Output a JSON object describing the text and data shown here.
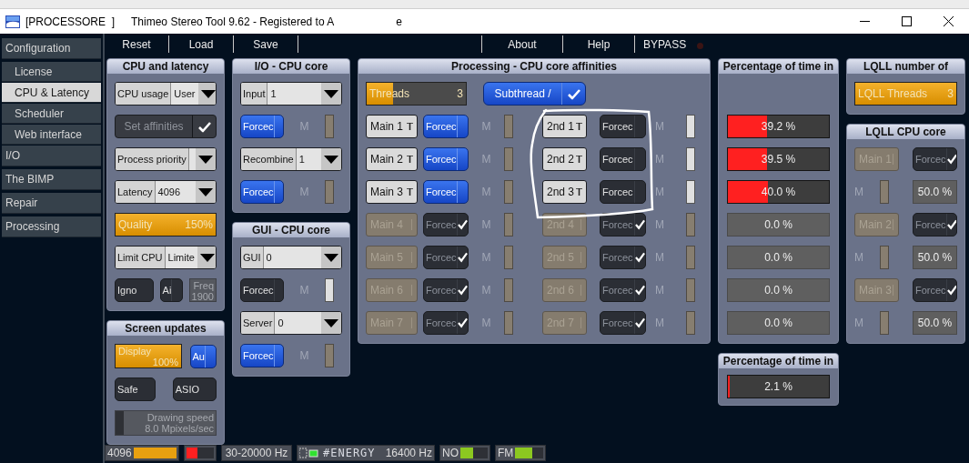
{
  "window": {
    "title_tag": "[PROCESSORE  ]",
    "title": "Thimeo Stereo Tool 9.62 - Registered to A",
    "title_tail": "e"
  },
  "sidebar": {
    "items": [
      {
        "label": "Configuration",
        "selected": false,
        "children": [
          {
            "label": "License",
            "selected": false
          },
          {
            "label": "CPU & Latency",
            "selected": true
          },
          {
            "label": "Scheduler",
            "selected": false
          },
          {
            "label": "Web interface",
            "selected": false
          }
        ]
      },
      {
        "label": "I/O",
        "selected": false
      },
      {
        "label": "The BIMP",
        "selected": false
      },
      {
        "label": "Repair",
        "selected": false
      },
      {
        "label": "Processing",
        "selected": false
      }
    ]
  },
  "toolbar": {
    "left": [
      "Reset",
      "Load",
      "Save"
    ],
    "right": [
      "About",
      "Help",
      "BYPASS"
    ],
    "bypass_on": false
  },
  "columns": [
    {
      "panels": [
        {
          "kind": "cpu",
          "title": "CPU and latency",
          "controls": [
            {
              "kind": "dropdown",
              "label": "CPU usage",
              "value": "User"
            },
            {
              "kind": "check_button",
              "label": "Set affinities",
              "checked": true,
              "disabled": true
            },
            {
              "kind": "dropdown",
              "label": "Process priority"
            },
            {
              "kind": "dropdown",
              "label": "Latency",
              "value": "4096"
            },
            {
              "kind": "slider",
              "label": "Quality",
              "reading": "150%",
              "level": 1
            },
            {
              "kind": "dropdown",
              "label": "Limit CPU",
              "value": "Limite"
            },
            {
              "kind": "row",
              "items": [
                {
                  "kind": "toggle",
                  "label": "Igno",
                  "on": false
                },
                {
                  "kind": "toggle",
                  "label": "Ai",
                  "on": false
                },
                {
                  "kind": "readout",
                  "label": "Freq",
                  "reading": "1900"
                }
              ]
            }
          ]
        },
        {
          "kind": "screen",
          "title": "Screen updates",
          "controls": [
            {
              "kind": "row",
              "items": [
                {
                  "kind": "slider",
                  "label": "Display",
                  "reading": "100%",
                  "level": 1
                },
                {
                  "kind": "toggle",
                  "label": "Au",
                  "on": true
                }
              ]
            },
            {
              "kind": "row",
              "items": [
                {
                  "kind": "toggle",
                  "label": "Safe",
                  "on": false
                },
                {
                  "kind": "toggle",
                  "label": "ASIO",
                  "on": false
                }
              ]
            },
            {
              "kind": "readout",
              "label": "Drawing speed",
              "reading": "8.0 Mpixels/sec",
              "level": 0.08
            }
          ]
        }
      ]
    },
    {
      "panels": [
        {
          "kind": "core",
          "title": "I/O - CPU core",
          "controls": [
            {
              "kind": "dropdown",
              "label": "Input",
              "value": "1"
            },
            {
              "kind": "force",
              "label": "Forcec",
              "checked": true,
              "m": "M",
              "m_on": false
            },
            {
              "kind": "dropdown",
              "label": "Recombine",
              "value": "1"
            },
            {
              "kind": "force",
              "label": "Forcec",
              "checked": true,
              "m": "M",
              "m_on": false
            }
          ]
        },
        {
          "kind": "core",
          "title": "GUI - CPU core",
          "controls": [
            {
              "kind": "dropdown",
              "label": "GUI",
              "value": "0"
            },
            {
              "kind": "force",
              "label": "Forcec",
              "checked": false,
              "m": "M",
              "m_on": true
            },
            {
              "kind": "dropdown",
              "label": "Server",
              "value": "0"
            },
            {
              "kind": "force",
              "label": "Forcec",
              "checked": true,
              "m": "M",
              "m_on": false
            }
          ]
        }
      ]
    },
    {
      "panels": [
        {
          "kind": "affinity",
          "title": "Processing - CPU core affinities",
          "threads": {
            "label": "Threads",
            "reading": "3",
            "level": 0.27
          },
          "subthread": {
            "label": "Subthread /",
            "checked": true
          },
          "rows": [
            {
              "main": {
                "label": "Main 1",
                "disabled": false,
                "force": "Forcec",
                "forced": true,
                "m": "M",
                "m_on": false
              },
              "second": {
                "label": "2nd 1",
                "disabled": false,
                "force": "Forcec",
                "forced": false,
                "m": "M",
                "m_on": true
              }
            },
            {
              "main": {
                "label": "Main 2",
                "disabled": false,
                "force": "Forcec",
                "forced": true,
                "m": "M",
                "m_on": false
              },
              "second": {
                "label": "2nd 2",
                "disabled": false,
                "force": "Forcec",
                "forced": false,
                "m": "M",
                "m_on": true
              }
            },
            {
              "main": {
                "label": "Main 3",
                "disabled": false,
                "force": "Forcec",
                "forced": true,
                "m": "M",
                "m_on": false
              },
              "second": {
                "label": "2nd 3",
                "disabled": false,
                "force": "Forcec",
                "forced": false,
                "m": "M",
                "m_on": true
              }
            },
            {
              "main": {
                "label": "Main 4",
                "disabled": true,
                "force": "Forcec",
                "forced": true,
                "m": "M",
                "m_on": false
              },
              "second": {
                "label": "2nd 4",
                "disabled": true,
                "force": "Forcec",
                "forced": true,
                "m": "M",
                "m_on": false
              }
            },
            {
              "main": {
                "label": "Main 5",
                "disabled": true,
                "force": "Forcec",
                "forced": true,
                "m": "M",
                "m_on": false
              },
              "second": {
                "label": "2nd 5",
                "disabled": true,
                "force": "Forcec",
                "forced": true,
                "m": "M",
                "m_on": false
              }
            },
            {
              "main": {
                "label": "Main 6",
                "disabled": true,
                "force": "Forcec",
                "forced": true,
                "m": "M",
                "m_on": false
              },
              "second": {
                "label": "2nd 6",
                "disabled": true,
                "force": "Forcec",
                "forced": true,
                "m": "M",
                "m_on": false
              }
            },
            {
              "main": {
                "label": "Main 7",
                "disabled": true,
                "force": "Forcec",
                "forced": true,
                "m": "M",
                "m_on": false
              },
              "second": {
                "label": "2nd 7",
                "disabled": true,
                "force": "Forcec",
                "forced": true,
                "m": "M",
                "m_on": false
              }
            }
          ]
        }
      ]
    },
    {
      "panels": [
        {
          "kind": "thread_usage",
          "title": "Percentage of time in",
          "bars": [
            {
              "reading": "39.2 %",
              "level": 0.39,
              "active": true
            },
            {
              "reading": "39.5 %",
              "level": 0.39,
              "active": true
            },
            {
              "reading": "40.0 %",
              "level": 0.4,
              "active": true
            },
            {
              "reading": "0.0 %",
              "active": false
            },
            {
              "reading": "0.0 %",
              "active": false
            },
            {
              "reading": "0.0 %",
              "active": false
            },
            {
              "reading": "0.0 %",
              "active": false
            }
          ]
        },
        {
          "kind": "total_usage",
          "title": "Percentage of time in",
          "bars": [
            {
              "reading": "2.1 %",
              "level": 0.021,
              "active": true
            }
          ]
        }
      ]
    },
    {
      "panels": [
        {
          "kind": "lqll_threads",
          "title": "LQLL number of",
          "slider": {
            "label": "LQLL Threads",
            "reading": "3",
            "level": 1
          }
        },
        {
          "kind": "lqll_core",
          "title": "LQLL CPU core",
          "items": [
            {
              "label": "Main 1",
              "disabled": true,
              "force": "Forcec",
              "forced": true,
              "m": "M",
              "m_on": false,
              "reading": "50.0 %"
            },
            {
              "label": "Main 2",
              "disabled": true,
              "force": "Forcec",
              "forced": true,
              "m": "M",
              "m_on": false,
              "reading": "50.0 %"
            },
            {
              "label": "Main 3",
              "disabled": true,
              "force": "Forcec",
              "forced": true,
              "m": "M",
              "m_on": false,
              "reading": "50.0 %"
            }
          ]
        }
      ]
    }
  ],
  "status_bar": [
    {
      "kind": "meter",
      "label": "4096",
      "level": 1,
      "color": "#e8a010"
    },
    {
      "kind": "meter",
      "level": 0.4,
      "color": "#ff2020"
    },
    {
      "kind": "text",
      "label": "30-20000 Hz"
    },
    {
      "kind": "energy",
      "label": "#ENERGY",
      "reading": "16400 Hz"
    },
    {
      "kind": "meter",
      "label": "NO",
      "level": 0.45,
      "color": "#8cc820"
    },
    {
      "kind": "meter",
      "label": "FM",
      "level": 0.6,
      "color": "#8cc820"
    }
  ]
}
